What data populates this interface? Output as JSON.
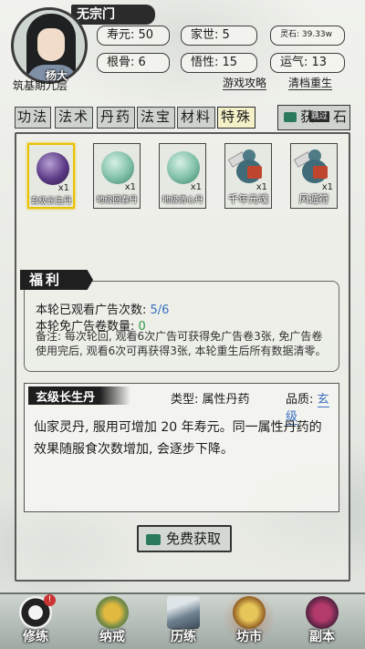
{
  "header": {
    "sect": "无宗门",
    "player_name": "杨大",
    "realm": "筑基期九层",
    "stats": {
      "lifespan": "寿元: 50",
      "family": "家世: 5",
      "spirit_stone": "灵石: 39.33w",
      "root_bone": "根骨: 6",
      "insight": "悟性: 15",
      "luck": "运气: 13"
    },
    "links": {
      "guide": "游戏攻略",
      "reset": "清档重生"
    }
  },
  "tabs": [
    "功法",
    "法术",
    "丹药",
    "法宝",
    "材料",
    "特殊"
  ],
  "active_tab": "特殊",
  "get_stone": {
    "label": "获",
    "label2": "石",
    "skip_badge": "跳过"
  },
  "items": [
    {
      "name": "玄级长生丹",
      "count": "x1",
      "icon": "purple-pill-icon"
    },
    {
      "name": "地级回春丹",
      "count": "x1",
      "icon": "green-pill-icon"
    },
    {
      "name": "地级清心丹",
      "count": "x1",
      "icon": "green-pill-icon"
    },
    {
      "name": "千年元魂",
      "count": "x1",
      "icon": "soul-gourd-icon"
    },
    {
      "name": "风遁符",
      "count": "x1",
      "icon": "wind-talisman-icon"
    }
  ],
  "welfare": {
    "title": "福利",
    "ads_watched_label": "本轮已观看广告次数:",
    "ads_watched_value": "5/6",
    "free_ad_label": "本轮免广告卷数量:",
    "free_ad_value": "0",
    "note": "备注: 每次轮回, 观看6次广告可获得免广告卷3张, 免广告卷使用完后, 观看6次可再获得3张, 本轮重生后所有数据清零。"
  },
  "detail": {
    "title": "玄级长生丹",
    "type_label": "类型: 属性丹药",
    "grade_label": "品质:",
    "grade_value": "玄级",
    "description": "仙家灵丹, 服用可增加 20 年寿元。同一属性丹药的效果随服食次数增加, 会逐步下降。"
  },
  "free_button": "免费获取",
  "bottom_nav": [
    {
      "label": "修练",
      "icon": "taiji-icon",
      "badge": "!"
    },
    {
      "label": "纳戒",
      "icon": "ring-icon"
    },
    {
      "label": "历练",
      "icon": "mountain-icon"
    },
    {
      "label": "坊市",
      "icon": "shop-icon",
      "active": true
    },
    {
      "label": "副本",
      "icon": "demon-icon"
    }
  ],
  "colors": {
    "accent_blue": "#3a6fbf",
    "accent_green": "#2f9b47",
    "selected_border": "#e8c200"
  }
}
